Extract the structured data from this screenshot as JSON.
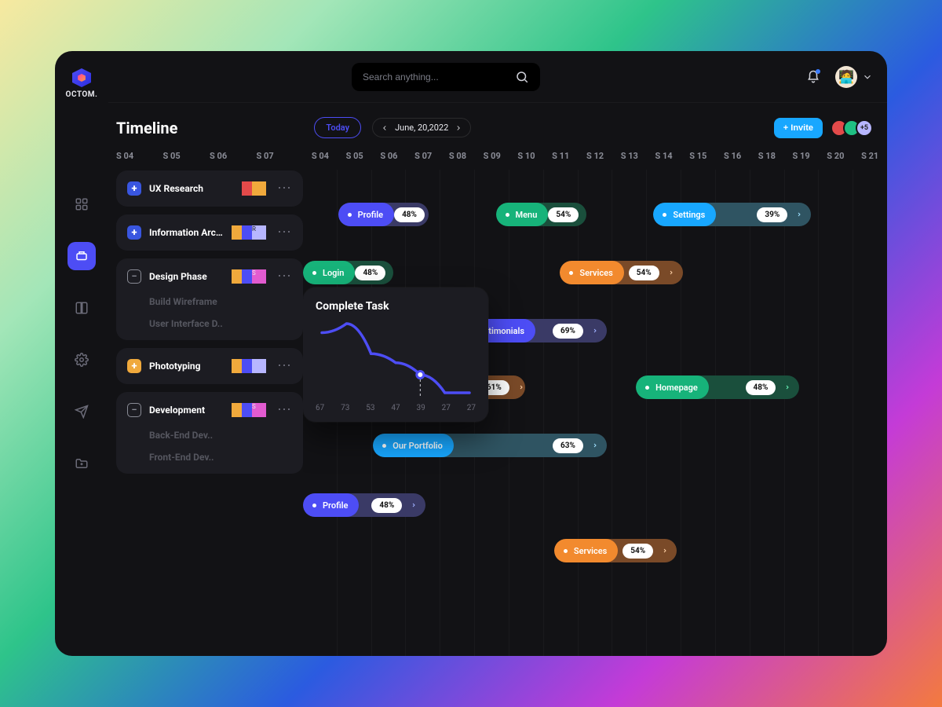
{
  "brand": "OCTOM.",
  "search": {
    "placeholder": "Search anything..."
  },
  "header": {
    "title": "Timeline",
    "today_label": "Today",
    "date_label": "June, 20,2022",
    "invite_label": "+ Invite",
    "extra_count": "+5"
  },
  "left_dates": [
    "S 04",
    "S 05",
    "S 06",
    "S 07"
  ],
  "grid_dates": [
    "S 04",
    "S 05",
    "S 06",
    "S 07",
    "S 08",
    "S 09",
    "S 10",
    "S 11",
    "S 12",
    "S 13",
    "S 14",
    "S 15",
    "S 16",
    "S 18",
    "S 19",
    "S 20",
    "S 21"
  ],
  "tasks": {
    "ux": {
      "title": "UX Research"
    },
    "info": {
      "title": "Information Arc..."
    },
    "design": {
      "title": "Design Phase",
      "sub1": "Build Wireframe",
      "sub2": "User Interface D.."
    },
    "proto": {
      "title": "Phototyping"
    },
    "dev": {
      "title": "Development",
      "sub1": "Back-End Dev..",
      "sub2": "Front-End Dev.."
    }
  },
  "bars": {
    "profile1": {
      "label": "Profile",
      "pct": "48%"
    },
    "menu": {
      "label": "Menu",
      "pct": "54%"
    },
    "settings": {
      "label": "Settings",
      "pct": "39%"
    },
    "login": {
      "label": "Login",
      "pct": "48%"
    },
    "services1": {
      "label": "Services",
      "pct": "54%"
    },
    "testimonials": {
      "label": "Testimonials",
      "pct": "69%"
    },
    "sixtyone": {
      "label": "",
      "pct": "61%"
    },
    "homepage": {
      "label": "Homepage",
      "pct": "48%"
    },
    "portfolio": {
      "label": "Our Portfolio",
      "pct": "63%"
    },
    "profile2": {
      "label": "Profile",
      "pct": "48%"
    },
    "services2": {
      "label": "Services",
      "pct": "54%"
    }
  },
  "popover": {
    "title": "Complete Task"
  },
  "chart_data": {
    "type": "line",
    "title": "Complete Task",
    "x_labels": [
      "67",
      "73",
      "53",
      "47",
      "39",
      "27",
      "27"
    ],
    "values": [
      67,
      73,
      53,
      47,
      39,
      27,
      27
    ],
    "highlight_index": 4
  }
}
